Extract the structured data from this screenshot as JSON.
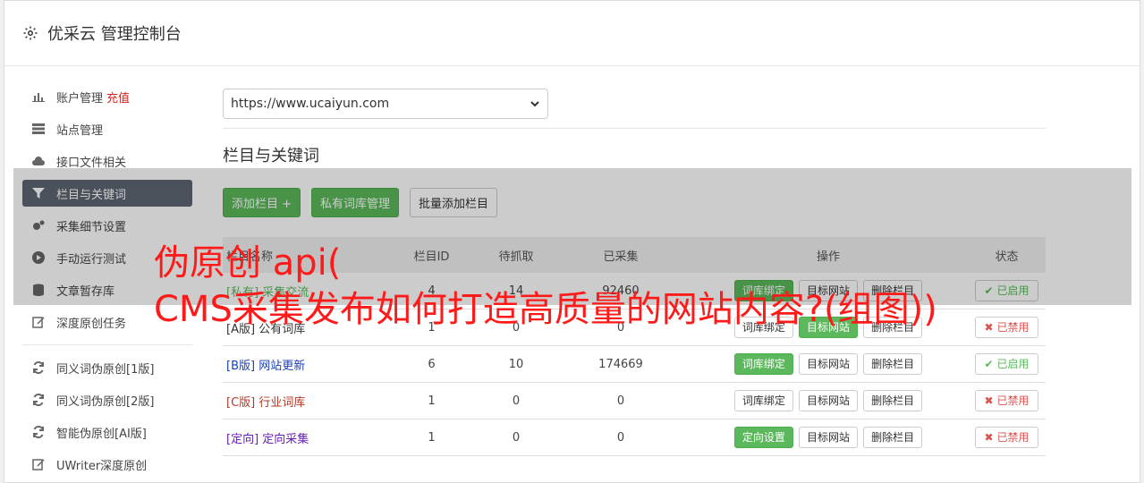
{
  "header": {
    "title": "优采云 管理控制台"
  },
  "sidebar": {
    "items": [
      {
        "label": "账户管理",
        "extra": "充值"
      },
      {
        "label": "站点管理"
      },
      {
        "label": "接口文件相关"
      },
      {
        "label": "栏目与关键词"
      },
      {
        "label": "采集细节设置"
      },
      {
        "label": "手动运行测试"
      },
      {
        "label": "文章暂存库"
      },
      {
        "label": "深度原创任务"
      },
      {
        "label": "同义词伪原创[1版]"
      },
      {
        "label": "同义词伪原创[2版]"
      },
      {
        "label": "智能伪原创[AI版]"
      },
      {
        "label": "UWriter深度原创"
      }
    ]
  },
  "main": {
    "site_select": "https://www.ucaiyun.com",
    "section_title": "栏目与关键词",
    "buttons": {
      "add_column": "添加栏目 +",
      "private_lib": "私有词库管理",
      "batch_add": "批量添加栏目"
    },
    "table": {
      "headers": [
        "栏目名称",
        "栏目ID",
        "待抓取",
        "已采集",
        "操作",
        "状态"
      ],
      "rows": [
        {
          "tag": "[私有]",
          "name": "采集交流",
          "id": "4",
          "pending": "14",
          "collected": "92460",
          "op1": "词库绑定",
          "op2": "目标网站",
          "op3": "删除栏目",
          "status": "已启用"
        },
        {
          "tag": "[A版]",
          "name": "公有词库",
          "id": "1",
          "pending": "0",
          "collected": "0",
          "op1": "词库绑定",
          "op2": "目标网站",
          "op3": "删除栏目",
          "status": "已禁用"
        },
        {
          "tag": "[B版]",
          "name": "网站更新",
          "id": "6",
          "pending": "10",
          "collected": "174669",
          "op1": "词库绑定",
          "op2": "目标网站",
          "op3": "删除栏目",
          "status": "已启用"
        },
        {
          "tag": "[C版]",
          "name": "行业词库",
          "id": "1",
          "pending": "0",
          "collected": "0",
          "op1": "词库绑定",
          "op2": "目标网站",
          "op3": "删除栏目",
          "status": "已禁用"
        },
        {
          "tag": "[定向]",
          "name": "定向采集",
          "id": "1",
          "pending": "0",
          "collected": "0",
          "op1": "定向设置",
          "op2": "目标网站",
          "op3": "删除栏目",
          "status": "已禁用"
        }
      ]
    }
  },
  "overlay": {
    "line1": "伪原创 api(",
    "line2": "CMS采集发布如何打造高质量的网站内容?(组图))"
  },
  "colors": {
    "green": "#5cb85c",
    "red": "#d9231e",
    "active": "#5d6671",
    "blue": "#337ab7"
  }
}
